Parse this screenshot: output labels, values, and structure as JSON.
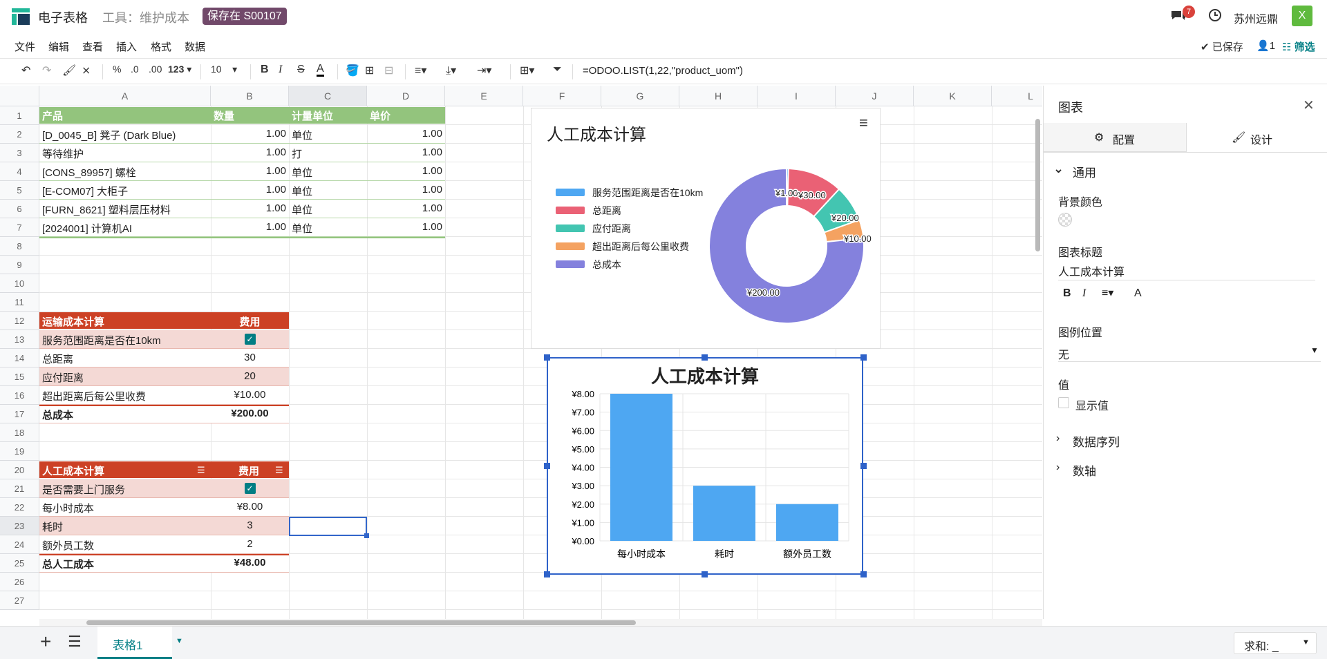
{
  "app": {
    "title": "电子表格",
    "tool_label": "工具：维护成本",
    "save_badge": "保存在 S00107",
    "chat_count": "7",
    "company": "苏州远鼎",
    "avatar": "X"
  },
  "menu": [
    "文件",
    "编辑",
    "查看",
    "插入",
    "格式",
    "数据"
  ],
  "status": {
    "saved": "已保存",
    "users": "1",
    "filter": "筛选"
  },
  "toolbar": {
    "percent": "%",
    "dec_less": ".0",
    "dec_more": ".00",
    "number_format": "123",
    "font_size": "10",
    "bold": "B",
    "italic": "I",
    "strike": "S",
    "text_color": "A"
  },
  "formula": "=ODOO.LIST(1,22,\"product_uom\")",
  "columns": [
    "A",
    "B",
    "C",
    "D",
    "E",
    "F",
    "G",
    "H",
    "I",
    "J",
    "K",
    "L"
  ],
  "rows": [
    "1",
    "2",
    "3",
    "4",
    "5",
    "6",
    "7",
    "8",
    "9",
    "10",
    "11",
    "12",
    "13",
    "14",
    "15",
    "16",
    "17",
    "18",
    "19",
    "20",
    "21",
    "22",
    "23",
    "24",
    "25",
    "26",
    "27"
  ],
  "product_table": {
    "headers": [
      "产品",
      "数量",
      "计量单位",
      "单价"
    ],
    "rows": [
      [
        "[D_0045_B] 凳子 (Dark Blue)",
        "1.00",
        "单位",
        "1.00"
      ],
      [
        "等待维护",
        "1.00",
        "打",
        "1.00"
      ],
      [
        "[CONS_89957] 螺栓",
        "1.00",
        "单位",
        "1.00"
      ],
      [
        "[E-COM07] 大柜子",
        "1.00",
        "单位",
        "1.00"
      ],
      [
        "[FURN_8621] 塑料层压材料",
        "1.00",
        "单位",
        "1.00"
      ],
      [
        "[2024001] 计算机AI",
        "1.00",
        "单位",
        "1.00"
      ]
    ]
  },
  "transport_table": {
    "header": [
      "运输成本计算",
      "费用"
    ],
    "rows": [
      [
        "服务范围距离是否在10km",
        ""
      ],
      [
        "总距离",
        "30"
      ],
      [
        "应付距离",
        "20"
      ],
      [
        "超出距离后每公里收费",
        "¥10.00"
      ]
    ],
    "total": [
      "总成本",
      "¥200.00"
    ]
  },
  "labor_table": {
    "header": [
      "人工成本计算",
      "费用"
    ],
    "rows": [
      [
        "是否需要上门服务",
        ""
      ],
      [
        "每小时成本",
        "¥8.00"
      ],
      [
        "耗时",
        "3"
      ],
      [
        "额外员工数",
        "2"
      ]
    ],
    "total": [
      "总人工成本",
      "¥48.00"
    ]
  },
  "chart_data": [
    {
      "type": "pie",
      "title": "人工成本计算",
      "legend_position": "left",
      "categories": [
        "服务范围距离是否在10km",
        "总距离",
        "应付距离",
        "超出距离后每公里收费",
        "总成本"
      ],
      "values": [
        1,
        30,
        20,
        10,
        200
      ],
      "data_labels": [
        "¥1.00",
        "¥30.00",
        "¥20.00",
        "¥10.00",
        "¥200.00"
      ],
      "colors": [
        "#4ea7f2",
        "#ea6175",
        "#43c5b1",
        "#f4a261",
        "#8481dd"
      ]
    },
    {
      "type": "bar",
      "title": "人工成本计算",
      "categories": [
        "每小时成本",
        "耗时",
        "额外员工数"
      ],
      "values": [
        8,
        3,
        2
      ],
      "ylim": [
        0,
        8
      ],
      "yticks": [
        "¥0.00",
        "¥1.00",
        "¥2.00",
        "¥3.00",
        "¥4.00",
        "¥5.00",
        "¥6.00",
        "¥7.00",
        "¥8.00"
      ],
      "grid": true,
      "legend": "none",
      "color": "#4ea7f2"
    }
  ],
  "panel": {
    "title": "图表",
    "tab_config": "配置",
    "tab_design": "设计",
    "section_general": "通用",
    "bg_color_label": "背景颜色",
    "chart_title_label": "图表标题",
    "chart_title_value": "人工成本计算",
    "legend_label": "图例位置",
    "legend_value": "无",
    "values_label": "值",
    "show_values": "显示值",
    "section_series": "数据序列",
    "section_axes": "数轴"
  },
  "bottom": {
    "sheet_name": "表格1",
    "sum_label": "求和: _"
  }
}
